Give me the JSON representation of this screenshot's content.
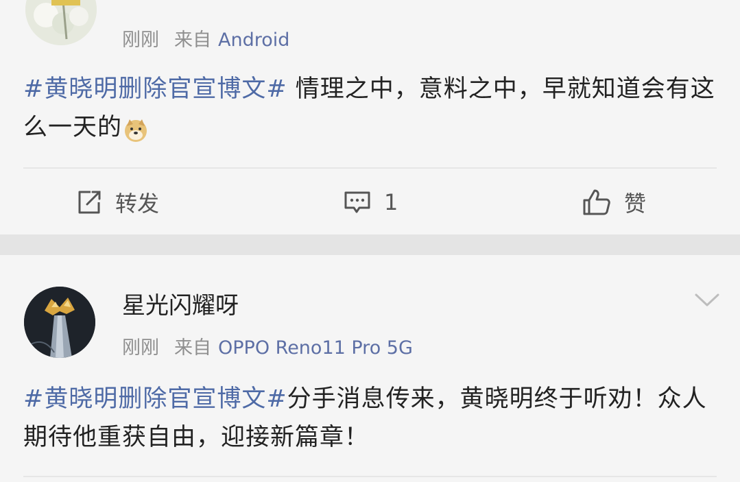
{
  "posts": [
    {
      "time": "刚刚",
      "source_label": "来自",
      "device": "Android",
      "content": {
        "hashtag": "#黄晓明删除官宣博文#",
        "text": " 情理之中，意料之中，早就知道会有这么一天的",
        "emoji": "doge-emoji"
      },
      "actions": {
        "repost_label": "转发",
        "comment_count": "1",
        "like_label": "赞"
      }
    },
    {
      "username": "星光闪耀呀",
      "time": "刚刚",
      "source_label": "来自",
      "device": "OPPO Reno11 Pro 5G",
      "content": {
        "hashtag": "#黄晓明删除官宣博文#",
        "text": "分手消息传来，黄晓明终于听劝！众人期待他重获自由，迎接新篇章！"
      }
    }
  ],
  "icons": {
    "repost": "share-icon",
    "comment": "comment-icon",
    "like": "thumbs-up-icon",
    "more": "chevron-down-icon"
  },
  "colors": {
    "hashtag": "#4e6aa6",
    "device": "#5d6fa5",
    "meta": "#8f8f8f",
    "background": "#f5f5f5",
    "separator": "#e4e4e4"
  }
}
